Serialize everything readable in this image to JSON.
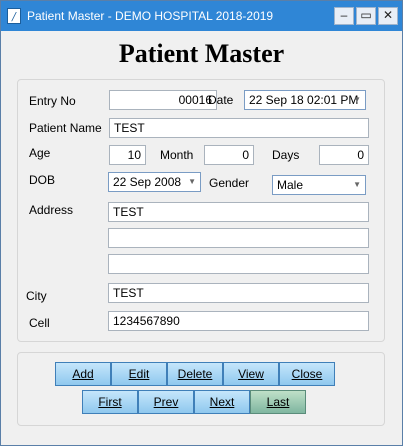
{
  "window": {
    "title": "Patient Master - DEMO HOSPITAL 2018-2019",
    "icon": "app-icon",
    "controls": {
      "minimize": "–",
      "maximize": "▭",
      "close": "✕"
    }
  },
  "heading": "Patient Master",
  "form": {
    "entry_no_label": "Entry No",
    "entry_no_value": "00016",
    "date_label": "Date",
    "date_value": "22 Sep 18  02:01 PM",
    "patient_name_label": "Patient Name",
    "patient_name_value": "TEST",
    "age_label": "Age",
    "age_value": "10",
    "month_label": "Month",
    "month_value": "0",
    "days_label": "Days",
    "days_value": "0",
    "dob_label": "DOB",
    "dob_value": "22 Sep 2008",
    "gender_label": "Gender",
    "gender_value": "Male",
    "address_label": "Address",
    "address_line1": "TEST",
    "address_line2": "",
    "address_line3": "",
    "city_label": "City",
    "city_value": "TEST",
    "cell_label": "Cell",
    "cell_value": "1234567890"
  },
  "buttons": {
    "add": "Add",
    "edit": "Edit",
    "delete": "Delete",
    "view": "View",
    "close": "Close",
    "first": "First",
    "prev": "Prev",
    "next": "Next",
    "last": "Last"
  },
  "colors": {
    "titlebar": "#2f86d6",
    "button": "#8fc8ee",
    "selected_button": "#7fb6a0"
  }
}
